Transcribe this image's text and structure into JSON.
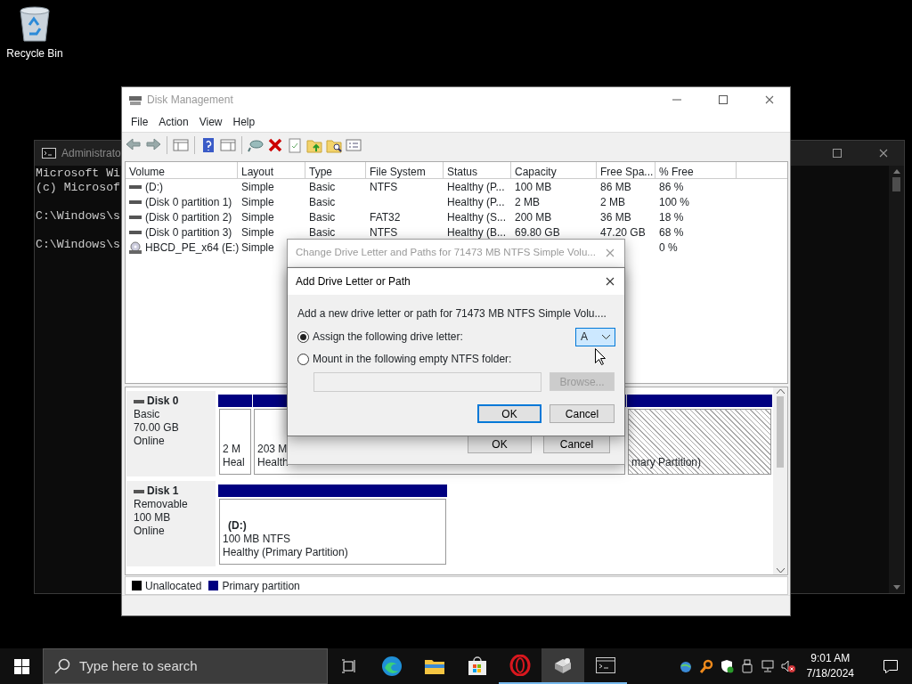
{
  "desktop_icons": [
    {
      "label": "Recycle Bin"
    }
  ],
  "console_window": {
    "title": "Administrato",
    "blocks": [
      [
        "Microsoft Wi",
        "(c) Microsof"
      ],
      [
        "C:\\Windows\\s"
      ],
      [
        "C:\\Windows\\s"
      ]
    ]
  },
  "disk_management": {
    "title": "Disk Management",
    "active": false,
    "menu": [
      "File",
      "Action",
      "View",
      "Help"
    ],
    "volume_table": {
      "columns": [
        "Volume",
        "Layout",
        "Type",
        "File System",
        "Status",
        "Capacity",
        "Free Spa...",
        "% Free"
      ],
      "rows": [
        {
          "kind": "disk",
          "cells": [
            "(D:)",
            "Simple",
            "Basic",
            "NTFS",
            "Healthy (P...",
            "100 MB",
            "86 MB",
            "86 %"
          ]
        },
        {
          "kind": "disk",
          "cells": [
            "(Disk 0 partition 1)",
            "Simple",
            "Basic",
            null,
            "Healthy (P...",
            "2 MB",
            "2 MB",
            "100 %"
          ]
        },
        {
          "kind": "disk",
          "cells": [
            "(Disk 0 partition 2)",
            "Simple",
            "Basic",
            "FAT32",
            "Healthy (S...",
            "200 MB",
            "36 MB",
            "18 %"
          ]
        },
        {
          "kind": "disk",
          "cells": [
            "(Disk 0 partition 3)",
            "Simple",
            "Basic",
            "NTFS",
            "Healthy (B...",
            "69.80 GB",
            "47.20 GB",
            "68 %"
          ]
        },
        {
          "kind": "cd",
          "cells": [
            "HBCD_PE_x64 (E:)",
            "Simple",
            null,
            null,
            null,
            null,
            null,
            "0 %"
          ]
        }
      ]
    },
    "disks": [
      {
        "name": "Disk 0",
        "type": "Basic",
        "size": "70.00 GB",
        "status": "Online",
        "partitions": [
          {
            "lines": [
              "2 M",
              "Heal"
            ],
            "color": "#000080",
            "selected": false
          },
          {
            "lines": [
              "203 M",
              "Health"
            ],
            "color": "#000080",
            "selected": false
          },
          {
            "lines": [
              "mary Partition)"
            ],
            "color": "#000080",
            "selected": true
          }
        ]
      },
      {
        "name": "Disk 1",
        "type": "Removable",
        "size": "100 MB",
        "status": "Online",
        "partitions": [
          {
            "name": "(D:)",
            "lines": [
              "100 MB NTFS",
              "Healthy (Primary Partition)"
            ],
            "color": "#000080",
            "selected": false
          }
        ]
      }
    ],
    "legend": [
      {
        "label": "Unallocated",
        "color": "#000000"
      },
      {
        "label": "Primary partition",
        "color": "#000080"
      }
    ]
  },
  "change_dialog": {
    "title": "Change Drive Letter and Paths for 71473 MB NTFS Simple Volu...",
    "active": false,
    "buttons": [
      {
        "label": "OK"
      },
      {
        "label": "Cancel"
      }
    ]
  },
  "add_dialog": {
    "title": "Add Drive Letter or Path",
    "prompt": "Add a new drive letter or path for 71473 MB NTFS Simple Volu....",
    "options": [
      {
        "label": "Assign the following drive letter:",
        "selected": true
      },
      {
        "label": "Mount in the following empty NTFS folder:",
        "selected": false
      }
    ],
    "drive_letter": {
      "value": "A",
      "focused": true
    },
    "folder_field": {
      "disabled": true
    },
    "browse_button": {
      "label": "Browse...",
      "disabled": true
    },
    "buttons": [
      {
        "label": "OK",
        "default": true
      },
      {
        "label": "Cancel",
        "default": false
      }
    ]
  },
  "taskbar": {
    "search_placeholder": "Type here to search",
    "apps": [
      {
        "kind": "edge",
        "running": false,
        "active": false
      },
      {
        "kind": "explorer",
        "running": false,
        "active": false
      },
      {
        "kind": "store",
        "running": false,
        "active": false
      },
      {
        "kind": "opera",
        "running": true,
        "active": false
      },
      {
        "kind": "diskmgmt",
        "running": true,
        "active": true
      },
      {
        "kind": "console",
        "running": true,
        "active": false
      }
    ],
    "time": "9:01 AM",
    "date": "7/18/2024"
  }
}
